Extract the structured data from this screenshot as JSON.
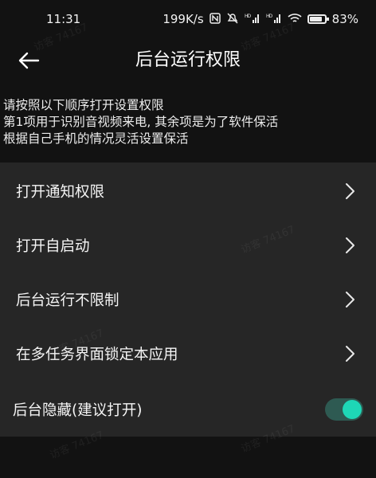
{
  "status_bar": {
    "time": "11:31",
    "net_speed": "199K/s",
    "battery": "83%",
    "icons": [
      "nfc-icon",
      "mute-icon",
      "signal-hd-icon",
      "signal-hd-icon",
      "wifi-icon",
      "battery-icon"
    ]
  },
  "header": {
    "title": "后台运行权限",
    "back_icon": "back-arrow-icon"
  },
  "intro": {
    "line1": "请按照以下顺序打开设置权限",
    "line2": "第1项用于识别音视频来电, 其余项是为了软件保活",
    "line3": "根据自己手机的情况灵活设置保活"
  },
  "settings": {
    "items": [
      {
        "label": "打开通知权限"
      },
      {
        "label": "打开自启动"
      },
      {
        "label": "后台运行不限制"
      },
      {
        "label": "在多任务界面锁定本应用"
      }
    ],
    "hidden_toggle": {
      "label": "后台隐藏(建议打开)",
      "on": true
    }
  },
  "watermark": "访客 74167",
  "colors": {
    "background": "#121212",
    "card": "#262626",
    "accent": "#1ed7b6"
  }
}
